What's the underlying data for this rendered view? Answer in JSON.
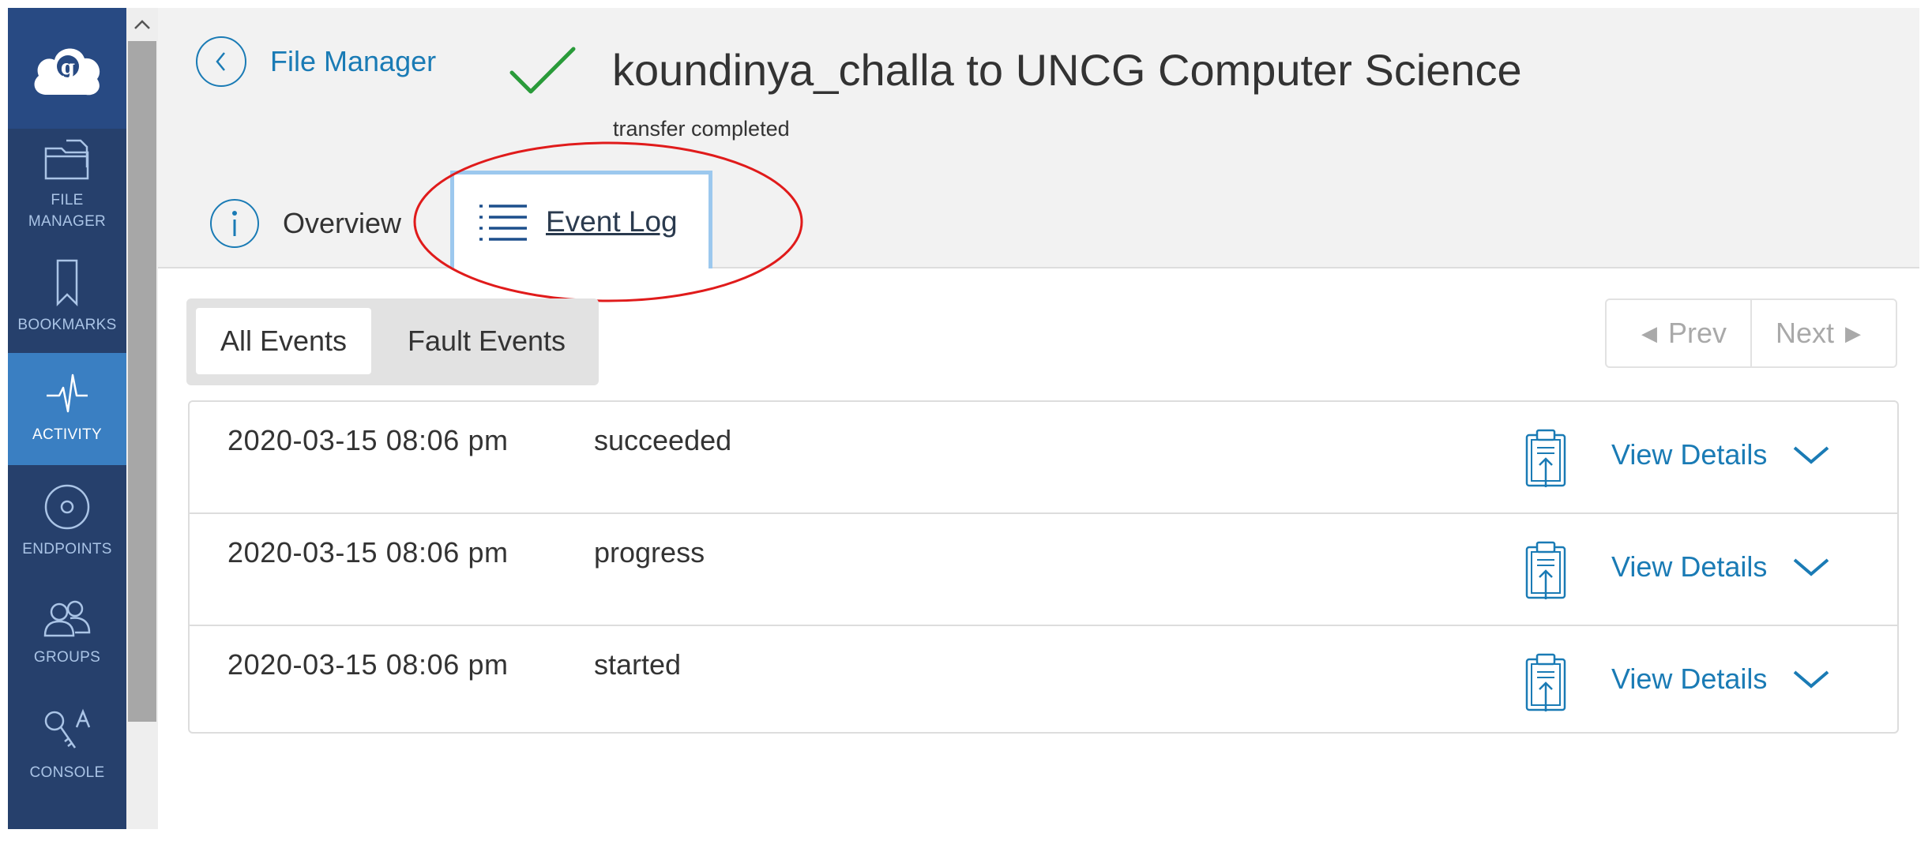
{
  "sidebar": {
    "items": [
      {
        "label": "FILE\nMANAGER",
        "icon": "file-manager-icon",
        "active": false
      },
      {
        "label": "BOOKMARKS",
        "icon": "bookmark-icon",
        "active": false
      },
      {
        "label": "ACTIVITY",
        "icon": "activity-icon",
        "active": true
      },
      {
        "label": "ENDPOINTS",
        "icon": "endpoint-icon",
        "active": false
      },
      {
        "label": "GROUPS",
        "icon": "groups-icon",
        "active": false
      },
      {
        "label": "CONSOLE",
        "icon": "console-icon",
        "active": false
      }
    ]
  },
  "header": {
    "back_label": "File Manager",
    "title": "koundinya_challa to UNCG Computer Science",
    "subtitle": "transfer completed",
    "tabs": [
      {
        "label": "Overview",
        "icon": "info-icon",
        "active": false
      },
      {
        "label": "Event Log",
        "icon": "list-icon",
        "active": true
      }
    ]
  },
  "filters": {
    "all_label": "All Events",
    "fault_label": "Fault Events",
    "selected": "All Events"
  },
  "pager": {
    "prev_label": "Prev",
    "next_label": "Next"
  },
  "events": [
    {
      "time": "2020-03-15 08:06 pm",
      "status": "succeeded",
      "details_label": "View Details"
    },
    {
      "time": "2020-03-15 08:06 pm",
      "status": "progress",
      "details_label": "View Details"
    },
    {
      "time": "2020-03-15 08:06 pm",
      "status": "started",
      "details_label": "View Details"
    }
  ],
  "colors": {
    "sidebar_bg": "#26406c",
    "sidebar_active": "#3a7fc2",
    "link_blue": "#1a7bb5",
    "success_green": "#2a9b3a",
    "annotation_red": "#e01b1b"
  }
}
